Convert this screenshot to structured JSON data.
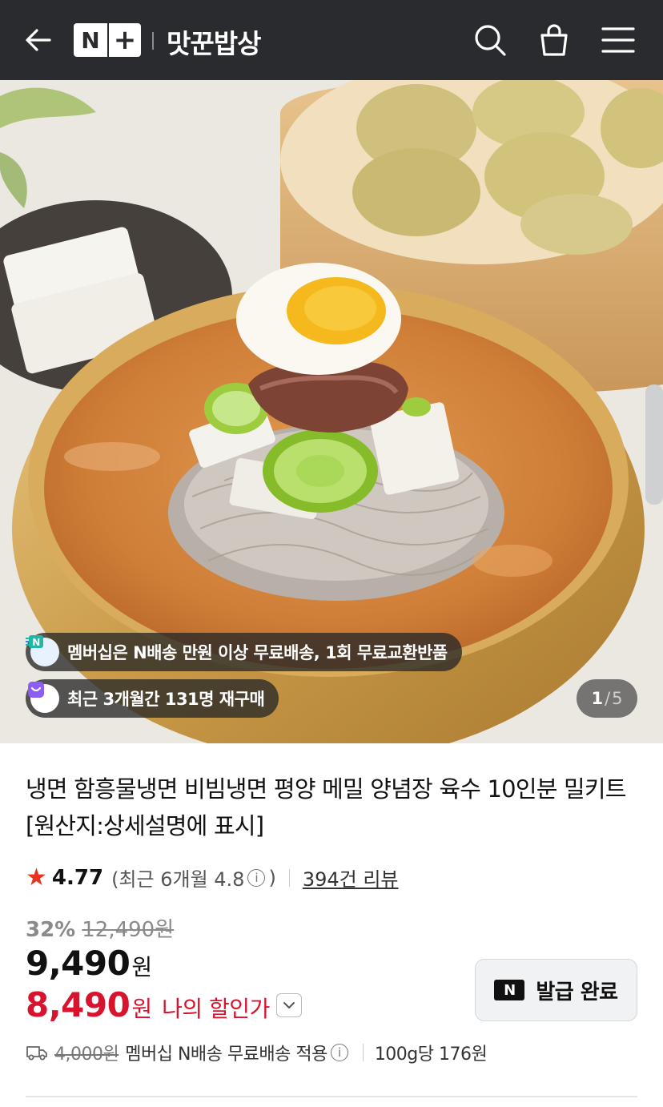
{
  "header": {
    "logo_n": "N",
    "logo_plus": "+",
    "title": "맛꾼밥상",
    "icons": [
      "back-arrow-icon",
      "search-icon",
      "shopping-bag-icon",
      "menu-icon"
    ],
    "background": "#2a2b2e"
  },
  "hero": {
    "chips": [
      {
        "icon": "n-delivery-icon",
        "text": "멤버십은 N배송 만원 이상 무료배송, 1회 무료교환반품"
      },
      {
        "icon": "repurchase-bag-icon",
        "text": "최근 3개월간 131명 재구매"
      }
    ],
    "pager": {
      "current": "1",
      "separator": "/",
      "total": "5"
    }
  },
  "product": {
    "title": "냉면 함흥물냉면 비빔냉면 평양 메밀 양념장 육수 10인분 밀키트 [원산지:상세설명에 표시]",
    "rating": "4.77",
    "recent_prefix": "(최근 6개월 4.8",
    "recent_suffix": ")",
    "reviews": "394건 리뷰",
    "discount_pct": "32%",
    "original_price": "12,490원",
    "price": "9,490",
    "price_unit": "원",
    "my_price": "8,490",
    "my_price_unit": "원",
    "my_price_label": "나의 할인가",
    "coupon_button": "발급 완료",
    "coupon_logo": "N",
    "shipping_old": "4,000원",
    "shipping_text": "멤버십 N배송 무료배송 적용",
    "unit_price": "100g당 176원",
    "accent_red": "#d7132e",
    "star_color": "#e8331e"
  }
}
